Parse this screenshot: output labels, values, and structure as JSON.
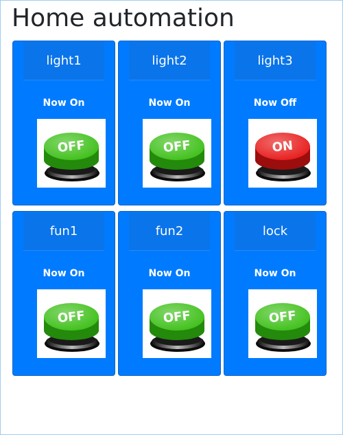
{
  "page": {
    "title": "Home automation"
  },
  "devices": [
    {
      "name": "light1",
      "status": "Now On",
      "button_label": "OFF",
      "button_color": "#3fc01a",
      "button_dark": "#238a0b"
    },
    {
      "name": "light2",
      "status": "Now On",
      "button_label": "OFF",
      "button_color": "#3fc01a",
      "button_dark": "#238a0b"
    },
    {
      "name": "light3",
      "status": "Now Off",
      "button_label": "ON",
      "button_color": "#e81c1c",
      "button_dark": "#9c0d0d"
    },
    {
      "name": "fun1",
      "status": "Now On",
      "button_label": "OFF",
      "button_color": "#3fc01a",
      "button_dark": "#238a0b"
    },
    {
      "name": "fun2",
      "status": "Now On",
      "button_label": "OFF",
      "button_color": "#3fc01a",
      "button_dark": "#238a0b"
    },
    {
      "name": "lock",
      "status": "Now On",
      "button_label": "OFF",
      "button_color": "#3fc01a",
      "button_dark": "#238a0b"
    }
  ],
  "colors": {
    "card_bg": "#007bff",
    "card_header_bg": "#0a74ea"
  },
  "icons": {
    "toggle": "push-button-icon"
  }
}
